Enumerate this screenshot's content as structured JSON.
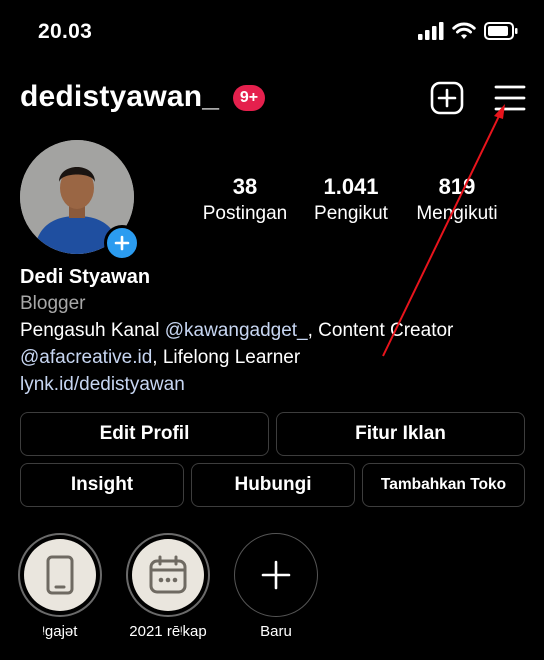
{
  "status_bar": {
    "time": "20.03",
    "signal_icon": "signal-bars-icon",
    "wifi_icon": "wifi-icon",
    "battery_icon": "battery-icon"
  },
  "header": {
    "username": "dedistyawan_",
    "notification_badge": "9+",
    "new_post_icon": "plus-square-icon",
    "menu_icon": "hamburger-menu-icon"
  },
  "profile": {
    "avatar_icon": "profile-photo",
    "add_story_icon": "plus-circle-icon",
    "stats": [
      {
        "value": "38",
        "label": "Postingan"
      },
      {
        "value": "1.041",
        "label": "Pengikut"
      },
      {
        "value": "819",
        "label": "Mengikuti"
      }
    ]
  },
  "bio": {
    "name": "Dedi Styawan",
    "category": "Blogger",
    "line1_prefix": "Pengasuh Kanal ",
    "line1_mention": "@kawangadget_",
    "line1_suffix": ", Content Creator",
    "line2_mention": "@afacreative.id",
    "line2_suffix": ", Lifelong Learner",
    "link": "lynk.id/dedistyawan"
  },
  "buttons": {
    "edit_profile": "Edit Profil",
    "ad_tools": "Fitur Iklan",
    "insight": "Insight",
    "contact": "Hubungi",
    "add_shop": "Tambahkan Toko"
  },
  "highlights": [
    {
      "label": "ᵎgajət",
      "icon": "smartphone-icon"
    },
    {
      "label": "2021 rēᵎkap",
      "icon": "calendar-icon"
    },
    {
      "label": "Baru",
      "icon": "plus-icon"
    }
  ],
  "annotation": {
    "color": "#e8141c",
    "description_icon": "red-arrow-annotation"
  },
  "colors": {
    "background": "#000000",
    "badge": "#e5204d",
    "avatar_add": "#2b9cf0",
    "link": "#c7d6f2",
    "secondary_text": "#a8a8a8"
  }
}
